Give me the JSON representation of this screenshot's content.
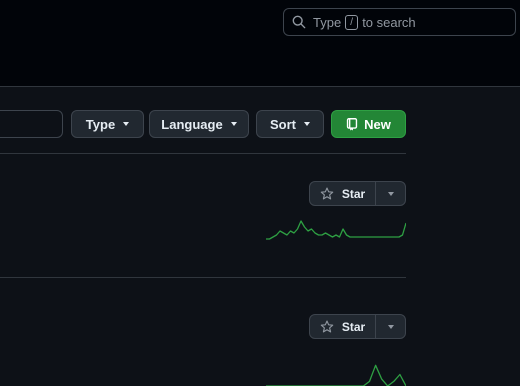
{
  "search": {
    "prefix": "Type",
    "key": "/",
    "suffix": "to search"
  },
  "filters": {
    "type_label": "Type",
    "language_label": "Language",
    "sort_label": "Sort",
    "new_label": "New"
  },
  "repos": [
    {
      "star_label": "Star",
      "activity": [
        0,
        0,
        1,
        2,
        4,
        3,
        2,
        4,
        3,
        5,
        9,
        6,
        4,
        5,
        3,
        2,
        2,
        3,
        2,
        1,
        2,
        1,
        5,
        2,
        1,
        1,
        1,
        1,
        1,
        1,
        1,
        1,
        1,
        1,
        1,
        1,
        1,
        1,
        1,
        2,
        8
      ]
    },
    {
      "star_label": "Star",
      "activity": [
        0,
        0,
        0,
        0,
        0,
        0,
        0,
        0,
        0,
        0,
        0,
        0,
        0,
        0,
        0,
        0,
        0,
        2,
        9,
        3,
        0,
        2,
        5,
        0
      ]
    }
  ],
  "colors": {
    "accent_green": "#238636",
    "spark": "#2ea043"
  }
}
